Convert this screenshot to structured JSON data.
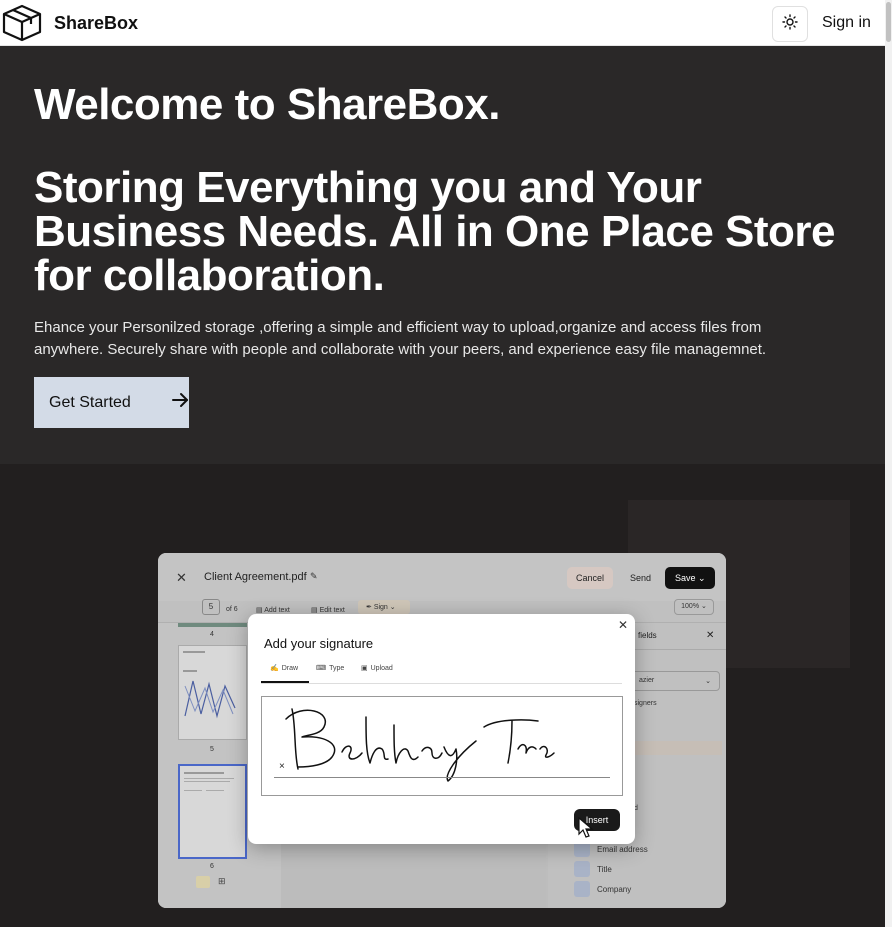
{
  "navbar": {
    "brand": "ShareBox",
    "theme_icon": "sun-icon",
    "signin_label": "Sign in"
  },
  "hero": {
    "welcome": "Welcome to ShareBox.",
    "tagline": "Storing Everything you and Your Business Needs. All in One Place Store for collaboration.",
    "description": "Ehance your Personilzed storage ,offering a simple and efficient way to upload,organize and access files from anywhere. Securely share with people and collaborate with your peers, and experience easy file managemnet.",
    "cta_label": "Get Started",
    "cta_icon": "arrow-right-icon"
  },
  "editor": {
    "file_name": "Client Agreement.pdf",
    "cancel_label": "Cancel",
    "send_label": "Send",
    "save_label": "Save",
    "page_current": "5",
    "page_total": "of 6",
    "add_text_label": "Add text",
    "edit_text_label": "Edit text",
    "sign_label": "Sign",
    "zoom": "100%",
    "thumbnails": [
      "4",
      "5",
      "6"
    ],
    "panel_title": "fields",
    "panel_select": "azier",
    "panel_signers": "signers",
    "panel_fields": [
      "Email address",
      "Title",
      "Company"
    ],
    "partial_d": "d"
  },
  "modal": {
    "title": "Add your signature",
    "tabs": [
      "Draw",
      "Type",
      "Upload"
    ],
    "active_tab": "Draw",
    "clear_label": "×",
    "insert_label": "Insert"
  },
  "colors": {
    "hero_bg": "#2a2828",
    "lower_bg": "#221f1f",
    "cta_bg": "#d3dbe7",
    "dark_button": "#111111"
  }
}
